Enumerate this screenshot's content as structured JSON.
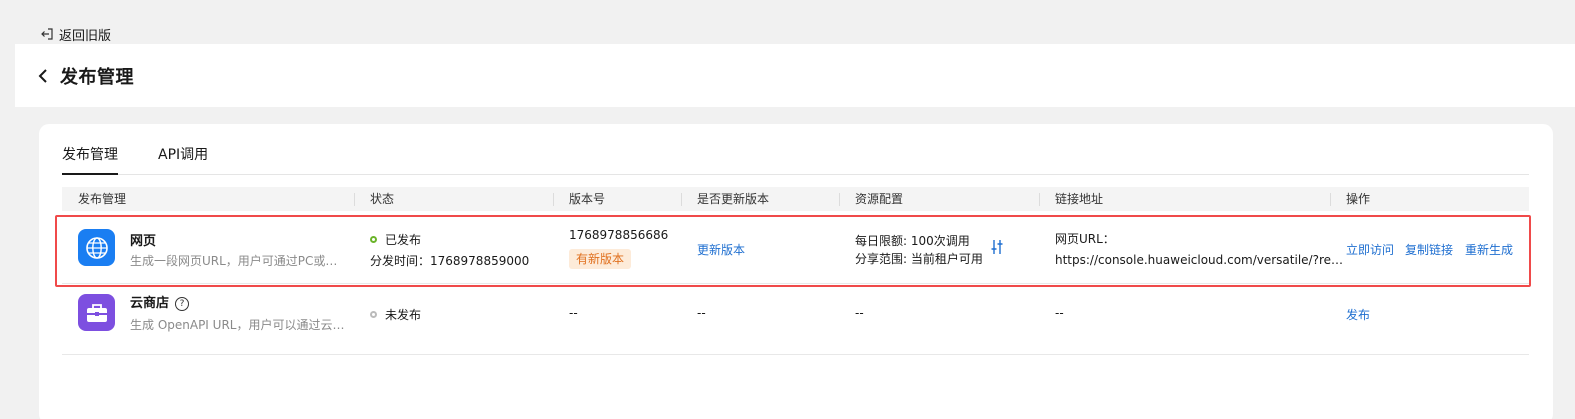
{
  "top": {
    "back_old_label": "返回旧版"
  },
  "header": {
    "title": "发布管理"
  },
  "tabs": [
    {
      "label": "发布管理"
    },
    {
      "label": "API调用"
    }
  ],
  "table": {
    "columns": [
      "发布管理",
      "状态",
      "版本号",
      "是否更新版本",
      "资源配置",
      "链接地址",
      "操作"
    ],
    "rows": [
      {
        "name": "网页",
        "desc": "生成一段网页URL，用户可通过PC或…",
        "status": "已发布",
        "publish_time": "分发时间：1768978859000",
        "version": "1768978856686",
        "version_badge": "有新版本",
        "update": "更新版本",
        "quota": "每日限额: 100次调用",
        "scope": "分享范围: 当前租户可用",
        "url_label": "网页URL：",
        "url": "https://console.huaweicloud.com/versatile/?re…",
        "actions": [
          "立即访问",
          "复制链接",
          "重新生成"
        ]
      },
      {
        "name": "云商店",
        "desc": "生成 OpenAPI URL，用户可以通过云…",
        "status": "未发布",
        "version": "--",
        "update": "--",
        "resource": "--",
        "link": "--",
        "actions": [
          "发布"
        ]
      }
    ]
  },
  "colors": {
    "accent_blue": "#1f6fd0",
    "web_icon_bg": "#1a7ef2",
    "store_icon_bg": "#7d4fe0",
    "published_green": "#6bb42a",
    "badge_orange": "#e0701f",
    "highlight_red": "#f04a4a"
  },
  "icons": {
    "back_old": "logout-icon",
    "header_back": "chevron-left-icon",
    "row1": "globe-icon",
    "row2": "briefcase-icon",
    "help": "question-circle-icon",
    "resource_settings": "sliders-icon"
  }
}
